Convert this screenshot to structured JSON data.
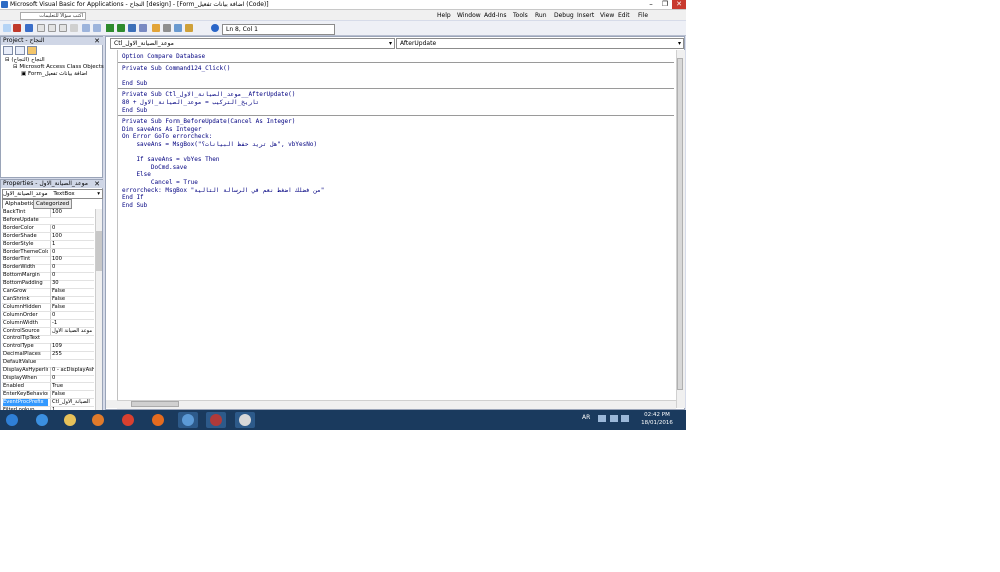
{
  "window": {
    "title": "Microsoft Visual Basic for Applications - النجاح [design] - [Form_اضافة بيانات تفعيل (Code)]",
    "controls": {
      "minimize": "–",
      "restore": "❐",
      "close": "✕"
    }
  },
  "menu": {
    "items": [
      "Help",
      "Window",
      "Add-Ins",
      "Tools",
      "Run",
      "Debug",
      "Insert",
      "View",
      "Edit",
      "File"
    ],
    "help_placeholder": "اكتب سؤالاً للتعليمات"
  },
  "toolbar": {
    "position": "Ln 8, Col 1"
  },
  "project": {
    "title": "Project - النجاح",
    "tree": [
      {
        "label": "(النجاح) النجاح",
        "level": 0
      },
      {
        "label": "Microsoft Access Class Objects",
        "level": 1
      },
      {
        "label": "Form_اضافة بيانات تفعيل",
        "level": 2
      }
    ]
  },
  "properties": {
    "title": "Properties - موعد_الصيانة_الاول",
    "object_name": "موعد_الصيانة_الاول",
    "object_type": "TextBox",
    "tabs": [
      "Alphabetic",
      "Categorized"
    ],
    "rows": [
      [
        "BackTint",
        "100"
      ],
      [
        "BeforeUpdate",
        ""
      ],
      [
        "BorderColor",
        "0"
      ],
      [
        "BorderShade",
        "100"
      ],
      [
        "BorderStyle",
        "1"
      ],
      [
        "BorderThemeColorI",
        "0"
      ],
      [
        "BorderTint",
        "100"
      ],
      [
        "BorderWidth",
        "0"
      ],
      [
        "BottomMargin",
        "0"
      ],
      [
        "BottomPadding",
        "30"
      ],
      [
        "CanGrow",
        "False"
      ],
      [
        "CanShrink",
        "False"
      ],
      [
        "ColumnHidden",
        "False"
      ],
      [
        "ColumnOrder",
        "0"
      ],
      [
        "ColumnWidth",
        "-1"
      ],
      [
        "ControlSource",
        "موعد الصيانة الاول"
      ],
      [
        "ControlTipText",
        ""
      ],
      [
        "ControlType",
        "109"
      ],
      [
        "DecimalPlaces",
        "255"
      ],
      [
        "DefaultValue",
        ""
      ],
      [
        "DisplayAsHyperlink",
        "0 - acDisplayAsHy"
      ],
      [
        "DisplayWhen",
        "0"
      ],
      [
        "Enabled",
        "True"
      ],
      [
        "EnterKeyBehavior",
        "False"
      ],
      [
        "EventProcPrefix",
        "Ctl_الصيانة_الاول"
      ],
      [
        "FilterLookup",
        "1"
      ]
    ],
    "selected_row": "EventProcPrefix"
  },
  "code": {
    "object_combo": "Ctl_موعد_الصيانة_الاول",
    "proc_combo": "AfterUpdate",
    "lines": [
      {
        "text": "Option Compare Database",
        "sep_after": true
      },
      {
        "text": "Private Sub Command124_Click()"
      },
      {
        "text": ""
      },
      {
        "text": "End Sub",
        "sep_after": true
      },
      {
        "text": "Private Sub Ctl_موعد_الصيانة_الاول__AfterUpdate()"
      },
      {
        "text": "تاريخ_التركيب = موعد_الصيانة_الاول + 80"
      },
      {
        "text": "End Sub",
        "sep_after": true
      },
      {
        "text": "Private Sub Form_BeforeUpdate(Cancel As Integer)"
      },
      {
        "text": "Dim saveAns As Integer"
      },
      {
        "text": "On Error GoTo errorcheck:"
      },
      {
        "text": "    saveAns = MsgBox(\"هل تريد حفظ البيانات؟\", vbYesNo)"
      },
      {
        "text": ""
      },
      {
        "text": "    If saveAns = vbYes Then"
      },
      {
        "text": "        DoCmd.save"
      },
      {
        "text": "    Else"
      },
      {
        "text": "        Cancel = True"
      },
      {
        "text": "errorcheck: MsgBox \"من فضلك اضغط نعم في الرسالة التالية\""
      },
      {
        "text": "End If"
      },
      {
        "text": "End Sub"
      }
    ]
  },
  "taskbar": {
    "lang": "AR",
    "time": "02:42 PM",
    "date": "18/01/2016",
    "apps": [
      {
        "name": "start",
        "color": "#2f7fd6"
      },
      {
        "name": "ie",
        "color": "#3b8fe0"
      },
      {
        "name": "explorer",
        "color": "#e6c15a"
      },
      {
        "name": "media",
        "color": "#e07a2b"
      },
      {
        "name": "chrome",
        "color": "#d9402f"
      },
      {
        "name": "firefox",
        "color": "#e56b1f"
      },
      {
        "name": "network",
        "color": "#5c9ad6"
      },
      {
        "name": "access",
        "color": "#b03a3a"
      },
      {
        "name": "paint",
        "color": "#d8d8d8"
      }
    ]
  }
}
